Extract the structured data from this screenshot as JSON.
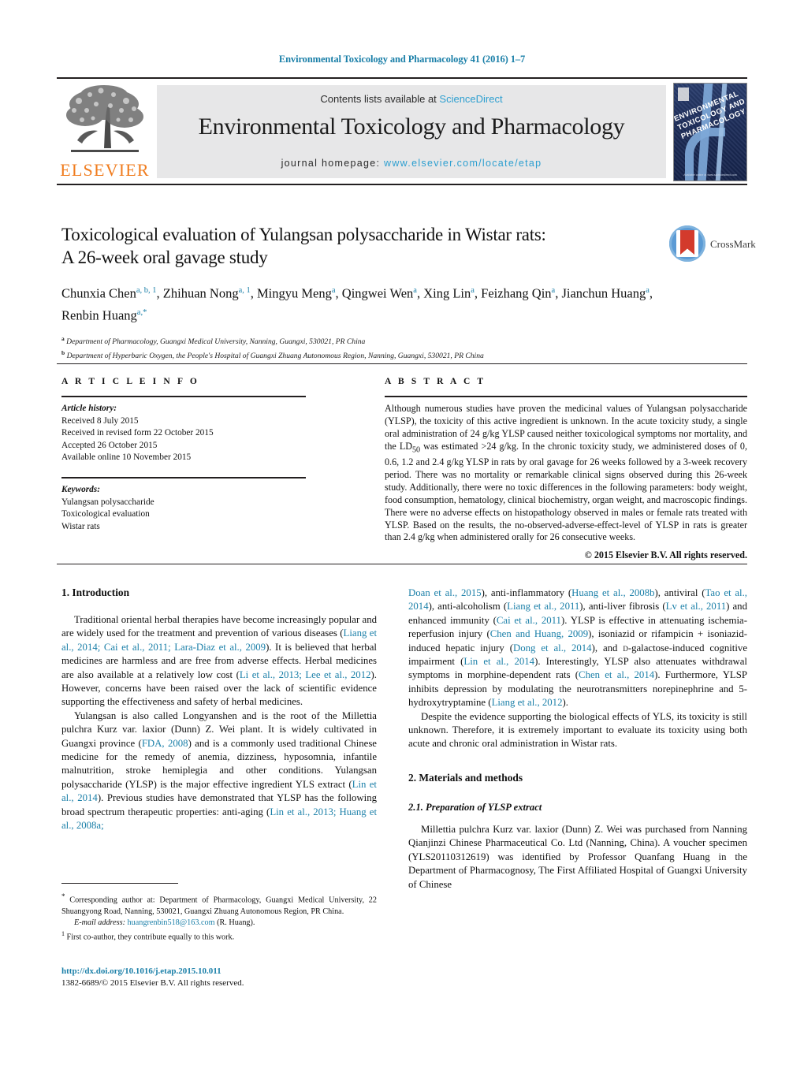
{
  "running_head": "Environmental Toxicology and Pharmacology 41 (2016) 1–7",
  "banner": {
    "contents_prefix": "Contents lists available at ",
    "sciencedirect": "ScienceDirect",
    "journal_title": "Environmental Toxicology and Pharmacology",
    "homepage_prefix": "journal homepage: ",
    "homepage_url": "www.elsevier.com/locate/etap",
    "publisher_wordmark": "ELSEVIER",
    "cover_text": "ENVIRONMENTAL TOXICOLOGY AND PHARMACOLOGY",
    "cover_footer": "Available online at www.sciencedirect.com"
  },
  "crossmark": {
    "label": "CrossMark"
  },
  "article": {
    "title_line1": "Toxicological evaluation of Yulangsan polysaccharide in Wistar rats:",
    "title_line2": "A 26-week oral gavage study",
    "authors_html": "Chunxia Chen<sup>a, b, 1</sup>, Zhihuan Nong<sup>a, 1</sup>, Mingyu Meng<sup>a</sup>, Qingwei Wen<sup>a</sup>, Xing Lin<sup>a</sup>, Feizhang Qin<sup>a</sup>, Jianchun Huang<sup>a</sup>, Renbin Huang<sup>a,*</sup>",
    "affiliation_a": "Department of Pharmacology, Guangxi Medical University, Nanning, Guangxi, 530021, PR China",
    "affiliation_b": "Department of Hyperbaric Oxygen, the People's Hospital of Guangxi Zhuang Autonomous Region, Nanning, Guangxi, 530021, PR China"
  },
  "info": {
    "heading": "A R T I C L E   I N F O",
    "history_label": "Article history:",
    "history": [
      "Received 8 July 2015",
      "Received in revised form 22 October 2015",
      "Accepted 26 October 2015",
      "Available online 10 November 2015"
    ],
    "keywords_label": "Keywords:",
    "keywords": [
      "Yulangsan polysaccharide",
      "Toxicological evaluation",
      "Wistar rats"
    ]
  },
  "abstract": {
    "heading": "A B S T R A C T",
    "text": "Although numerous studies have proven the medicinal values of Yulangsan polysaccharide (YLSP), the toxicity of this active ingredient is unknown. In the acute toxicity study, a single oral administration of 24 g/kg YLSP caused neither toxicological symptoms nor mortality, and the LD50 was estimated >24 g/kg. In the chronic toxicity study, we administered doses of 0, 0.6, 1.2 and 2.4 g/kg YLSP in rats by oral gavage for 26 weeks followed by a 3-week recovery period. There was no mortality or remarkable clinical signs observed during this 26-week study. Additionally, there were no toxic differences in the following parameters: body weight, food consumption, hematology, clinical biochemistry, organ weight, and macroscopic findings. There were no adverse effects on histopathology observed in males or female rats treated with YLSP. Based on the results, the no-observed-adverse-effect-level of YLSP in rats is greater than 2.4 g/kg when administered orally for 26 consecutive weeks.",
    "copyright": "© 2015 Elsevier B.V. All rights reserved."
  },
  "sections": {
    "intro_heading": "1.  Introduction",
    "intro_p1_html": "Traditional oriental herbal therapies have become increasingly popular and are widely used for the treatment and prevention of various diseases (<span class=\"ref\">Liang et al., 2014; Cai et al., 2011; Lara-Diaz et al., 2009</span>). It is believed that herbal medicines are harmless and are free from adverse effects. Herbal medicines are also available at a relatively low cost (<span class=\"ref\">Li et al., 2013; Lee et al., 2012</span>). However, concerns have been raised over the lack of scientific evidence supporting the effectiveness and safety of herbal medicines.",
    "intro_p2_html": "Yulangsan is also called Longyanshen and is the root of the Millettia pulchra Kurz var. laxior (Dunn) Z. Wei plant. It is widely cultivated in Guangxi province (<span class=\"ref\">FDA, 2008</span>) and is a commonly used traditional Chinese medicine for the remedy of anemia, dizziness, hyposomnia, infantile malnutrition, stroke hemiplegia and other conditions. Yulangsan polysaccharide (YLSP) is the major effective ingredient YLS extract (<span class=\"ref\">Lin et al., 2014</span>). Previous studies have demonstrated that YLSP has the following broad spectrum therapeutic properties: anti-aging (<span class=\"ref\">Lin et al., 2013; Huang et al., 2008a;</span>",
    "intro_p2_cont_html": "<span class=\"ref\">Doan et al., 2015</span>), anti-inflammatory (<span class=\"ref\">Huang et al., 2008b</span>), antiviral (<span class=\"ref\">Tao et al., 2014</span>), anti-alcoholism (<span class=\"ref\">Liang et al., 2011</span>), anti-liver fibrosis (<span class=\"ref\">Lv et al., 2011</span>) and enhanced immunity (<span class=\"ref\">Cai et al., 2011</span>). YLSP is effective in attenuating ischemia-reperfusion injury (<span class=\"ref\">Chen and Huang, 2009</span>), isoniazid or rifampicin + isoniazid-induced hepatic injury (<span class=\"ref\">Dong et al., 2014</span>), and <span style=\"font-variant:small-caps\">d</span>-galactose-induced cognitive impairment (<span class=\"ref\">Lin et al., 2014</span>). Interestingly, YLSP also attenuates withdrawal symptoms in morphine-dependent rats (<span class=\"ref\">Chen et al., 2014</span>). Furthermore, YLSP inhibits depression by modulating the neurotransmitters norepinephrine and 5-hydroxytryptamine (<span class=\"ref\">Liang et al., 2012</span>).",
    "intro_p3_html": "Despite the evidence supporting the biological effects of YLS, its toxicity is still unknown. Therefore, it is extremely important to evaluate its toxicity using both acute and chronic oral administration in Wistar rats.",
    "methods_heading": "2.  Materials and methods",
    "methods_sub_heading": "2.1.  Preparation of YLSP extract",
    "methods_p1_html": "Millettia pulchra Kurz var. laxior (Dunn) Z. Wei was purchased from Nanning Qianjinzi Chinese Pharmaceutical Co. Ltd (Nanning, China). A voucher specimen (YLS20110312619) was identified by Professor Quanfang Huang in the Department of Pharmacognosy, The First Affiliated Hospital of Guangxi University of Chinese"
  },
  "footnotes": {
    "corresponding_html": "<sup class=\"star\">*</sup> Corresponding author at: Department of Pharmacology, Guangxi Medical University, 22 Shuangyong Road, Nanning, 530021, Guangxi Zhuang Autonomous Region, PR China.",
    "email_label": "E-mail address:",
    "email": "huangrenbin518@163.com",
    "email_suffix": "(R. Huang).",
    "co_author_html": "<sup>1</sup> First co-author, they contribute equally to this work."
  },
  "doi": {
    "url": "http://dx.doi.org/10.1016/j.etap.2015.10.011",
    "issn_line": "1382-6689/© 2015 Elsevier B.V. All rights reserved."
  },
  "colors": {
    "link": "#1a7fa8",
    "sciencedirect": "#2d9fd0",
    "elsevier_orange": "#f07c1e",
    "crossmark_blue": "#5b9bd5",
    "crossmark_red": "#d33a2c",
    "banner_grey": "#e7e7e8"
  }
}
